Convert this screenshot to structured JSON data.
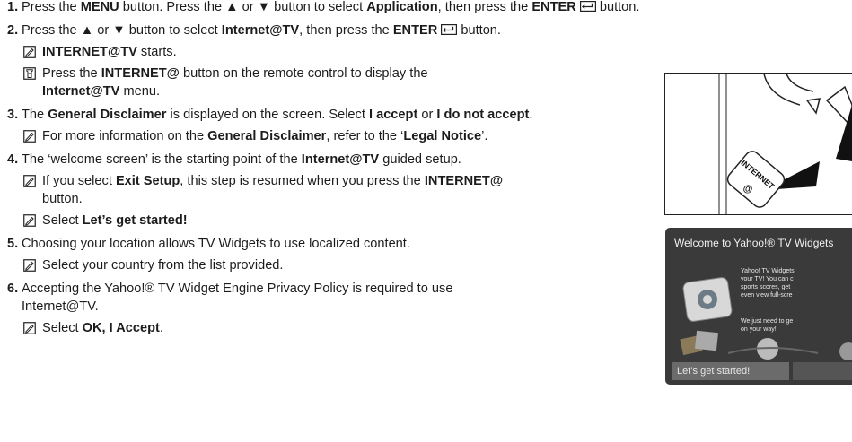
{
  "steps": [
    {
      "number": "1.",
      "runs": [
        {
          "t": "Press the "
        },
        {
          "t": "MENU",
          "b": true
        },
        {
          "t": " button. Press the ▲ or ▼ button to select "
        },
        {
          "t": "Application",
          "b": true
        },
        {
          "t": ", then press the "
        },
        {
          "t": "ENTER",
          "b": true
        },
        {
          "icon": "enter-key-icon"
        },
        {
          "t": " button."
        }
      ],
      "notes": []
    },
    {
      "number": "2.",
      "runs": [
        {
          "t": "Press the ▲ or ▼ button to select "
        },
        {
          "t": "Internet@TV",
          "b": true
        },
        {
          "t": ", then press the "
        },
        {
          "t": "ENTER",
          "b": true
        },
        {
          "icon": "enter-key-icon"
        },
        {
          "t": " button."
        }
      ],
      "notes": [
        {
          "icon": "note-icon",
          "runs": [
            {
              "t": "INTERNET@TV",
              "b": true
            },
            {
              "t": " starts."
            }
          ]
        },
        {
          "icon": "remote-icon",
          "runs": [
            {
              "t": "Press the "
            },
            {
              "t": "INTERNET@",
              "b": true
            },
            {
              "t": " button on the remote control to display the "
            },
            {
              "br": true
            },
            {
              "t": "Internet@TV",
              "b": true
            },
            {
              "t": " menu."
            }
          ]
        }
      ]
    },
    {
      "number": "3.",
      "runs": [
        {
          "t": "The "
        },
        {
          "t": "General Disclaimer",
          "b": true
        },
        {
          "t": " is displayed on the screen. Select "
        },
        {
          "t": "I accept",
          "b": true
        },
        {
          "t": " or "
        },
        {
          "t": "I do not accept",
          "b": true
        },
        {
          "t": "."
        }
      ],
      "notes": [
        {
          "icon": "note-icon",
          "runs": [
            {
              "t": "For more information on the "
            },
            {
              "t": "General Disclaimer",
              "b": true
            },
            {
              "t": ", refer to the ‘"
            },
            {
              "t": "Legal Notice",
              "b": true
            },
            {
              "t": "’."
            }
          ]
        }
      ]
    },
    {
      "number": "4.",
      "runs": [
        {
          "t": "The ‘welcome screen’ is the starting point of the "
        },
        {
          "t": "Internet@TV",
          "b": true
        },
        {
          "t": " guided setup."
        }
      ],
      "notes": [
        {
          "icon": "note-icon",
          "runs": [
            {
              "t": "If you select "
            },
            {
              "t": "Exit Setup",
              "b": true
            },
            {
              "t": ", this step is resumed when you press the "
            },
            {
              "t": "INTERNET@",
              "b": true
            },
            {
              "br": true
            },
            {
              "t": "button."
            }
          ]
        },
        {
          "icon": "note-icon",
          "runs": [
            {
              "t": "Select "
            },
            {
              "t": "Let’s get started!",
              "b": true
            }
          ]
        }
      ]
    },
    {
      "number": "5.",
      "runs": [
        {
          "t": "Choosing your location allows TV Widgets to use localized content."
        }
      ],
      "notes": [
        {
          "icon": "note-icon",
          "runs": [
            {
              "t": "Select your country from the list provided."
            }
          ]
        }
      ]
    },
    {
      "number": "6.",
      "runs": [
        {
          "t": "Accepting the Yahoo!® TV Widget Engine Privacy Policy is required to use "
        },
        {
          "br": true
        },
        {
          "t": "Internet@TV."
        }
      ],
      "notes": [
        {
          "icon": "note-icon",
          "runs": [
            {
              "t": "Select "
            },
            {
              "t": "OK, I Accept",
              "b": true
            },
            {
              "t": "."
            }
          ]
        }
      ]
    }
  ],
  "remote_image": {
    "button_label": "INTERNET",
    "button_symbol": "@"
  },
  "tv_screen": {
    "title": "Welcome to Yahoo!® TV Widgets",
    "body_lines": [
      "Yahoo! TV Widgets",
      "your TV! You can c",
      "sports scores, get",
      "even view full-scre"
    ],
    "body2_lines": [
      "We just need to ge",
      "on your way!"
    ],
    "button_label": "Let’s get started!"
  }
}
